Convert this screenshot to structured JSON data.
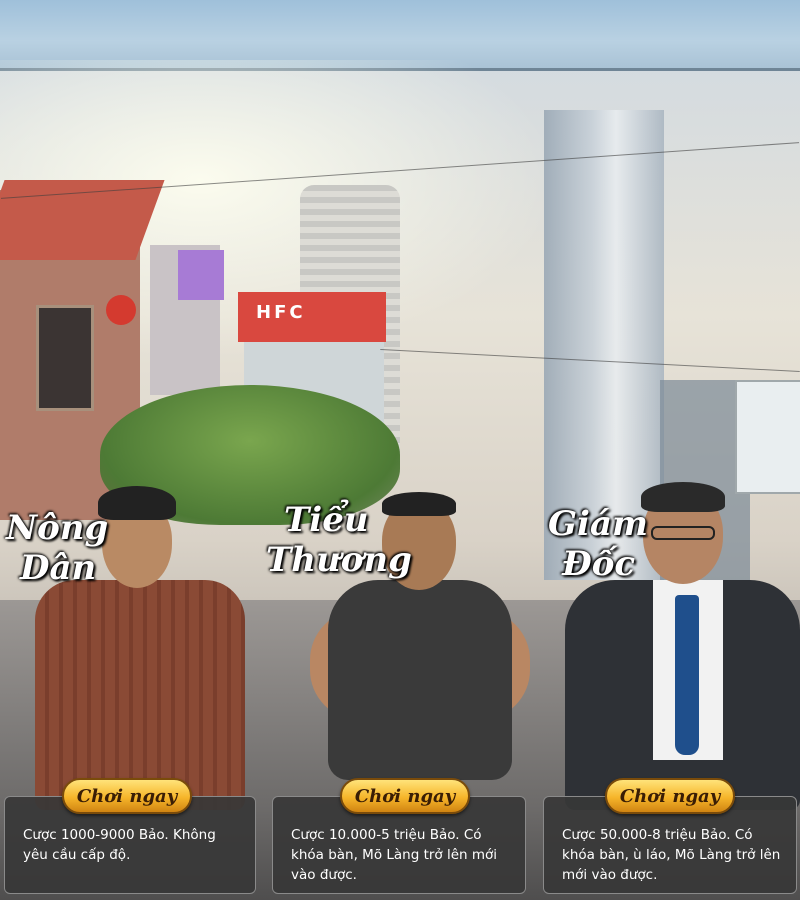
{
  "characters": [
    {
      "name_line1": "Nông",
      "name_line2": "Dân",
      "button": "Chơi ngay",
      "description": "Cược 1000-9000 Bảo. Không yêu cầu cấp độ."
    },
    {
      "name_line1": "Tiểu",
      "name_line2": "Thương",
      "button": "Chơi ngay",
      "description": "Cược 10.000-5 triệu Bảo. Có khóa bàn, Mõ Làng trở lên mới vào được."
    },
    {
      "name_line1": "Giám",
      "name_line2": "Đốc",
      "button": "Chơi ngay",
      "description": "Cược 50.000-8 triệu Bảo. Có khóa bàn, ù láo, Mõ Làng trở lên mới vào được."
    }
  ],
  "scene": {
    "sign_text": "HFC"
  },
  "colors": {
    "button_gold": "#f6b52a",
    "panel_dark": "#373737"
  }
}
